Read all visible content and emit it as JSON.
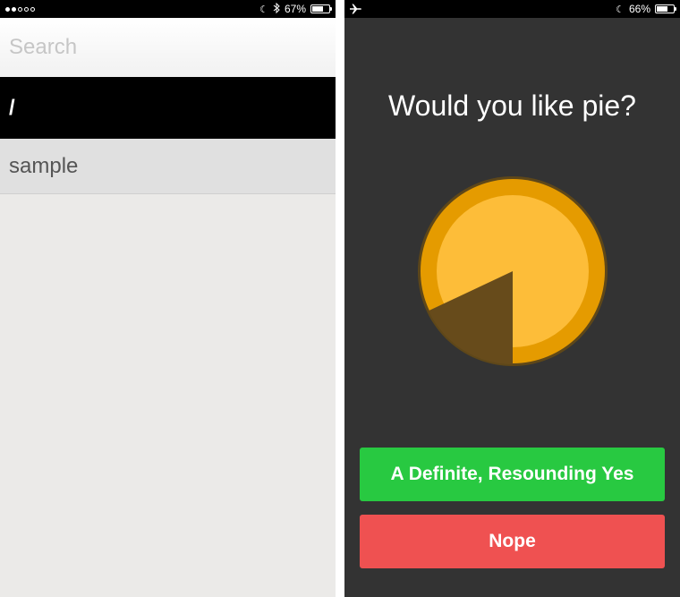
{
  "left_screen": {
    "status_bar": {
      "battery": "67%"
    },
    "search": {
      "placeholder": "Search",
      "value": ""
    },
    "list": {
      "items": [
        {
          "label": "/",
          "selected": true
        },
        {
          "label": "sample",
          "selected": false
        }
      ]
    }
  },
  "right_screen": {
    "status_bar": {
      "battery": "66%",
      "airplane_icon": "airplane-icon"
    },
    "question": "Would you like pie?",
    "pie": {
      "remaining_fraction": 0.82
    },
    "buttons": {
      "yes_label": "A Definite, Resounding Yes",
      "no_label": "Nope"
    }
  },
  "colors": {
    "yes_green": "#28c941",
    "no_red": "#ef5151",
    "pie_crust": "#e59b00",
    "pie_filling": "#fdbd39",
    "pie_missing": "#674b1b",
    "dark_background": "#333333"
  }
}
